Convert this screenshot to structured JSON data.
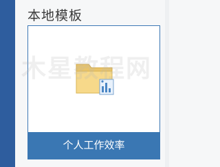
{
  "section": {
    "title": "本地模板"
  },
  "template_card": {
    "label": "个人工作效率",
    "icon": "folder-chart-icon"
  },
  "watermark": {
    "text": "木星教程网"
  },
  "colors": {
    "accent": "#3a77b3",
    "left_bar": "#2e5d9e",
    "folder": "#f7d98a"
  }
}
